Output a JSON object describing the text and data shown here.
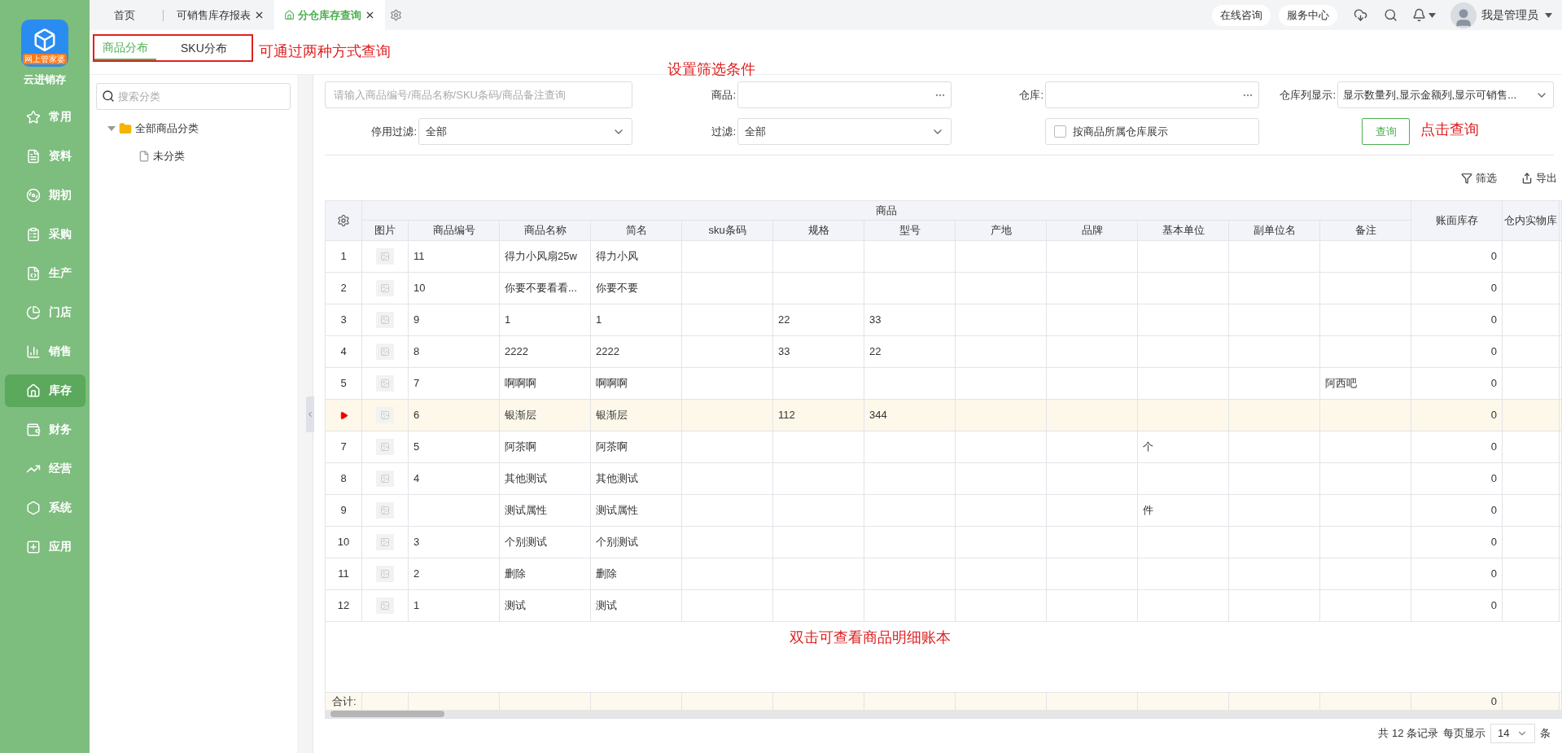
{
  "app": {
    "badge": "网上管家婆",
    "name": "云进销存"
  },
  "nav": [
    {
      "label": "常用",
      "selected": false
    },
    {
      "label": "资料",
      "selected": false
    },
    {
      "label": "期初",
      "selected": false
    },
    {
      "label": "采购",
      "selected": false
    },
    {
      "label": "生产",
      "selected": false
    },
    {
      "label": "门店",
      "selected": false
    },
    {
      "label": "销售",
      "selected": false
    },
    {
      "label": "库存",
      "selected": true
    },
    {
      "label": "财务",
      "selected": false
    },
    {
      "label": "经营",
      "selected": false
    },
    {
      "label": "系统",
      "selected": false
    },
    {
      "label": "应用",
      "selected": false
    }
  ],
  "tabs": [
    {
      "label": "首页",
      "selected": false,
      "closable": false
    },
    {
      "label": "可销售库存报表",
      "selected": false,
      "closable": true
    },
    {
      "label": "分仓库存查询",
      "selected": true,
      "closable": true
    }
  ],
  "header": {
    "buttons": [
      "在线咨询",
      "服务中心"
    ],
    "user": "我是管理员"
  },
  "subtabs": {
    "highlighted": true,
    "items": [
      {
        "label": "商品分布",
        "selected": true
      },
      {
        "label": "SKU分布",
        "selected": false
      }
    ]
  },
  "category": {
    "placeholder": "搜索分类",
    "tree": [
      {
        "label": "全部商品分类",
        "expanded": true,
        "children": [
          {
            "label": "未分类"
          }
        ]
      }
    ]
  },
  "filters": {
    "search_placeholder": "请输入商品编号/商品名称/SKU条码/商品备注查询",
    "product_label": "商品:",
    "warehouse_label": "仓库:",
    "columns_label": "仓库列显示:",
    "columns_value": "显示数量列,显示金额列,显示可销售...",
    "disabled_label": "停用过滤:",
    "disabled_value": "全部",
    "filter_label": "过滤:",
    "filter_value": "全部",
    "by_warehouse": {
      "label": "按商品所属仓库展示",
      "checked": false
    },
    "query": "查询"
  },
  "toolbar": [
    "筛选",
    "导出"
  ],
  "table": {
    "group": "商品",
    "columns": [
      {
        "label": "图片",
        "kind": "image"
      },
      {
        "label": "商品编号",
        "kind": "text"
      },
      {
        "label": "商品名称",
        "kind": "text"
      },
      {
        "label": "简名",
        "kind": "text"
      },
      {
        "label": "sku条码",
        "kind": "text"
      },
      {
        "label": "规格",
        "kind": "text"
      },
      {
        "label": "型号",
        "kind": "text"
      },
      {
        "label": "产地",
        "kind": "text"
      },
      {
        "label": "品牌",
        "kind": "text"
      },
      {
        "label": "基本单位",
        "kind": "text"
      },
      {
        "label": "副单位名",
        "kind": "text"
      },
      {
        "label": "备注",
        "kind": "text"
      },
      {
        "label": "账面库存",
        "kind": "number",
        "total": "0"
      },
      {
        "label": "仓内实物库",
        "kind": "number"
      }
    ],
    "rows": [
      {
        "no": "1",
        "selected": false,
        "cells": [
          null,
          "11",
          "得力小风扇25w",
          "得力小风",
          null,
          null,
          null,
          null,
          null,
          null,
          null,
          null,
          "0",
          null
        ]
      },
      {
        "no": "2",
        "selected": false,
        "cells": [
          null,
          "10",
          "你要不要看看...",
          "你要不要",
          null,
          null,
          null,
          null,
          null,
          null,
          null,
          null,
          "0",
          null
        ]
      },
      {
        "no": "3",
        "selected": false,
        "cells": [
          null,
          "9",
          "1",
          "1",
          null,
          "22",
          "33",
          null,
          null,
          null,
          null,
          null,
          "0",
          null
        ]
      },
      {
        "no": "4",
        "selected": false,
        "cells": [
          null,
          "8",
          "2222",
          "2222",
          null,
          "33",
          "22",
          null,
          null,
          null,
          null,
          null,
          "0",
          null
        ]
      },
      {
        "no": "5",
        "selected": false,
        "cells": [
          null,
          "7",
          "啊啊啊",
          "啊啊啊",
          null,
          null,
          null,
          null,
          null,
          null,
          null,
          "阿西吧",
          "0",
          null
        ]
      },
      {
        "selected": true,
        "cells": [
          null,
          "6",
          "银渐层",
          "银渐层",
          null,
          "112",
          "344",
          null,
          null,
          null,
          null,
          null,
          "0",
          null
        ]
      },
      {
        "no": "7",
        "selected": false,
        "cells": [
          null,
          "5",
          "阿茶啊",
          "阿茶啊",
          null,
          null,
          null,
          null,
          null,
          "个",
          null,
          null,
          "0",
          null
        ]
      },
      {
        "no": "8",
        "selected": false,
        "cells": [
          null,
          "4",
          "其他测试",
          "其他测试",
          null,
          null,
          null,
          null,
          null,
          null,
          null,
          null,
          "0",
          null
        ]
      },
      {
        "no": "9",
        "selected": false,
        "cells": [
          null,
          null,
          "测试属性",
          "测试属性",
          null,
          null,
          null,
          null,
          null,
          "件",
          null,
          null,
          "0",
          null
        ]
      },
      {
        "no": "10",
        "selected": false,
        "cells": [
          null,
          "3",
          "个别测试",
          "个别测试",
          null,
          null,
          null,
          null,
          null,
          null,
          null,
          null,
          "0",
          null
        ]
      },
      {
        "no": "11",
        "selected": false,
        "cells": [
          null,
          "2",
          "删除",
          "删除",
          null,
          null,
          null,
          null,
          null,
          null,
          null,
          null,
          "0",
          null
        ]
      },
      {
        "no": "12",
        "selected": false,
        "cells": [
          null,
          "1",
          "测试",
          "测试",
          null,
          null,
          null,
          null,
          null,
          null,
          null,
          null,
          "0",
          null
        ]
      }
    ],
    "footer": {
      "label": "合计:"
    }
  },
  "pagination": {
    "summary": "共 12 条记录",
    "per_page_label": "每页显示",
    "per_page": "14",
    "unit": "条"
  },
  "annotations": [
    "可通过两种方式查询",
    "设置筛选条件",
    "点击查询",
    "双击可查看商品明细账本"
  ]
}
